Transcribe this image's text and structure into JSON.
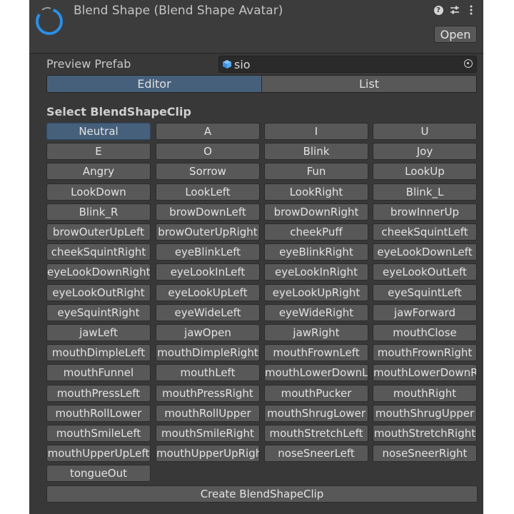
{
  "header": {
    "title": "Blend Shape (Blend Shape Avatar)",
    "open_label": "Open",
    "icons": [
      "help-icon",
      "settings-sliders-icon",
      "more-menu-icon"
    ]
  },
  "preview": {
    "label": "Preview Prefab",
    "value": "sio"
  },
  "tabs": [
    {
      "label": "Editor",
      "active": true
    },
    {
      "label": "List",
      "active": false
    }
  ],
  "section_title": "Select BlendShapeClip",
  "clips": [
    "Neutral",
    "A",
    "I",
    "U",
    "E",
    "O",
    "Blink",
    "Joy",
    "Angry",
    "Sorrow",
    "Fun",
    "LookUp",
    "LookDown",
    "LookLeft",
    "LookRight",
    "Blink_L",
    "Blink_R",
    "browDownLeft",
    "browDownRight",
    "browInnerUp",
    "browOuterUpLeft",
    "browOuterUpRight",
    "cheekPuff",
    "cheekSquintLeft",
    "cheekSquintRight",
    "eyeBlinkLeft",
    "eyeBlinkRight",
    "eyeLookDownLeft",
    "eyeLookDownRight",
    "eyeLookInLeft",
    "eyeLookInRight",
    "eyeLookOutLeft",
    "eyeLookOutRight",
    "eyeLookUpLeft",
    "eyeLookUpRight",
    "eyeSquintLeft",
    "eyeSquintRight",
    "eyeWideLeft",
    "eyeWideRight",
    "jawForward",
    "jawLeft",
    "jawOpen",
    "jawRight",
    "mouthClose",
    "mouthDimpleLeft",
    "mouthDimpleRight",
    "mouthFrownLeft",
    "mouthFrownRight",
    "mouthFunnel",
    "mouthLeft",
    "mouthLowerDownLeft",
    "mouthLowerDownRight",
    "mouthPressLeft",
    "mouthPressRight",
    "mouthPucker",
    "mouthRight",
    "mouthRollLower",
    "mouthRollUpper",
    "mouthShrugLower",
    "mouthShrugUpper",
    "mouthSmileLeft",
    "mouthSmileRight",
    "mouthStretchLeft",
    "mouthStretchRight",
    "mouthUpperUpLeft",
    "mouthUpperUpRight",
    "noseSneerLeft",
    "noseSneerRight",
    "tongueOut"
  ],
  "selected_clip": "Neutral",
  "create_label": "Create BlendShapeClip",
  "colors": {
    "panel": "#383838",
    "button": "#585858",
    "selected": "#46607c",
    "accent_ring": "#2a8fe6"
  }
}
